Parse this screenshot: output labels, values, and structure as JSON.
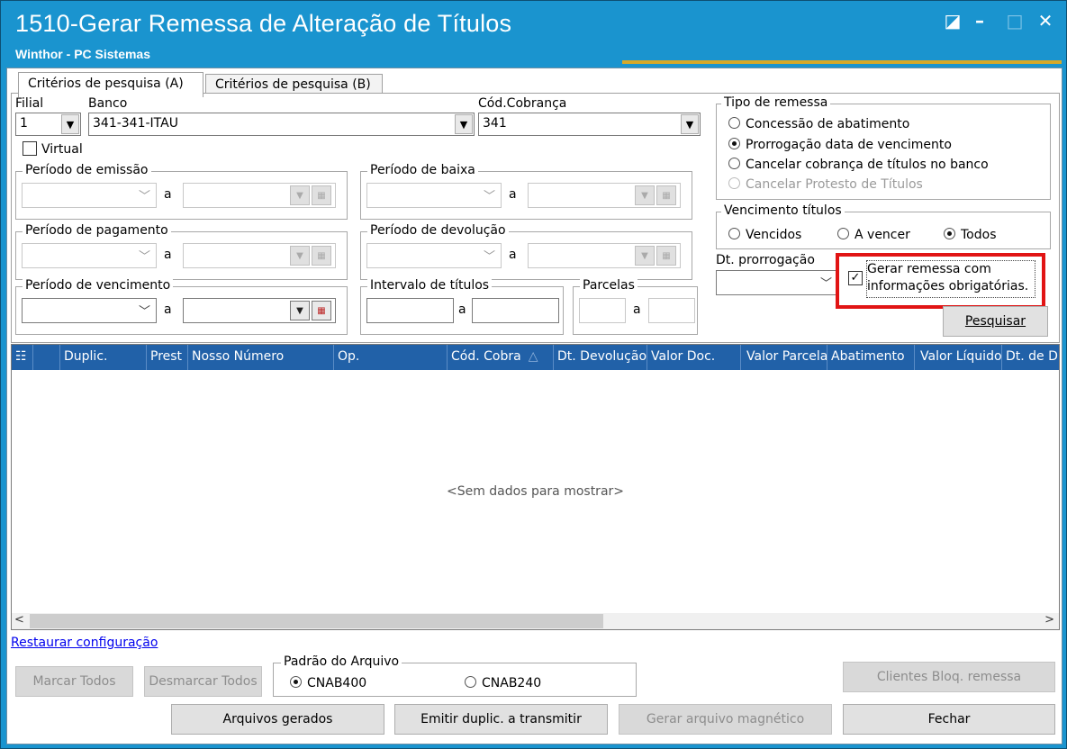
{
  "window": {
    "title": "1510-Gerar Remessa de Alteração de Títulos",
    "subtitle": "Winthor - PC Sistemas",
    "controls": {
      "restore": "◪",
      "minimize": "–",
      "maximize": "□",
      "close": "✕"
    }
  },
  "tabs": [
    {
      "label": "Critérios de pesquisa (A)",
      "active": true
    },
    {
      "label": "Critérios de pesquisa (B)",
      "active": false
    }
  ],
  "filters": {
    "filial_label": "Filial",
    "filial_value": "1",
    "banco_label": "Banco",
    "banco_value": "341-341-ITAU",
    "cod_cobranca_label": "Cód.Cobrança",
    "cod_cobranca_value": "341",
    "virtual_label": "Virtual",
    "virtual_checked": false,
    "a": "a",
    "periodo_emissao": "Período de emissão",
    "periodo_baixa": "Período de baixa",
    "periodo_pagamento": "Período de pagamento",
    "periodo_devolucao": "Período de devolução",
    "periodo_vencimento": "Período de vencimento",
    "intervalo_titulos": "Intervalo de títulos",
    "parcelas": "Parcelas"
  },
  "tipo_remessa": {
    "label": "Tipo de remessa",
    "options": [
      {
        "label": "Concessão de abatimento",
        "selected": false,
        "enabled": true
      },
      {
        "label": "Prorrogação data de vencimento",
        "selected": true,
        "enabled": true
      },
      {
        "label": "Cancelar cobrança de títulos no banco",
        "selected": false,
        "enabled": true
      },
      {
        "label": "Cancelar Protesto de Títulos",
        "selected": false,
        "enabled": false
      }
    ]
  },
  "vencimento_titulos": {
    "label": "Vencimento títulos",
    "options": [
      {
        "label": "Vencidos",
        "selected": false
      },
      {
        "label": "A vencer",
        "selected": false
      },
      {
        "label": "Todos",
        "selected": true
      }
    ]
  },
  "dt_prorrogacao_label": "Dt. prorrogação",
  "gerar_remessa": {
    "line1": "Gerar remessa com",
    "line2": "informações obrigatórias.",
    "checked": true
  },
  "pesquisar_button": "Pesquisar",
  "grid": {
    "columns": [
      "Duplic.",
      "Prest",
      "Nosso Número",
      "Op.",
      "Cód. Cobra",
      "Dt. Devolução",
      "Valor Doc.",
      "Valor Parcela",
      "Abatimento",
      "Valor Líquido",
      "Dt. de D"
    ],
    "empty_text": "<Sem dados para mostrar>",
    "column_menu_icon": "☷"
  },
  "restaurar_link": "Restaurar configuração",
  "padrao_arquivo": {
    "label": "Padrão do Arquivo",
    "options": [
      {
        "label": "CNAB400",
        "selected": true
      },
      {
        "label": "CNAB240",
        "selected": false
      }
    ]
  },
  "buttons": {
    "marcar_todos": "Marcar Todos",
    "desmarcar_todos": "Desmarcar Todos",
    "clientes_bloq": "Clientes Bloq. remessa",
    "arquivos_gerados": "Arquivos gerados",
    "emitir_duplic": "Emitir duplic. a transmitir",
    "gerar_arquivo": "Gerar arquivo magnético",
    "fechar": "Fechar"
  },
  "colors": {
    "titlebar": "#1a94cf",
    "grid_header": "#2161a8",
    "highlight": "#e11414",
    "accent_line": "#d6a92a"
  }
}
